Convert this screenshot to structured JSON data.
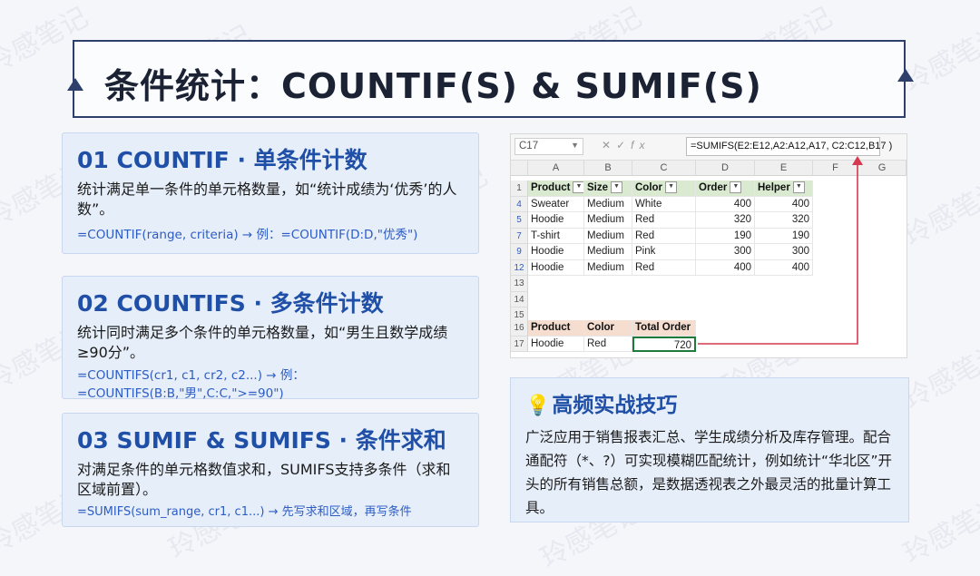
{
  "watermark": "玲感笔记",
  "title": "条件统计：COUNTIF(S) & SUMIF(S)",
  "cards": [
    {
      "heading": "01 COUNTIF · 单条件计数",
      "desc": "统计满足单一条件的单元格数量，如“统计成绩为‘优秀’的人数”。",
      "formula": "=COUNTIF(range, criteria) → 例：=COUNTIF(D:D,\"优秀\")"
    },
    {
      "heading": "02 COUNTIFS · 多条件计数",
      "desc": "统计同时满足多个条件的单元格数量，如“男生且数学成绩≥90分”。",
      "formula": "=COUNTIFS(cr1, c1, cr2, c2...) → 例：=COUNTIFS(B:B,\"男\",C:C,\">=90\")"
    },
    {
      "heading": "03 SUMIF & SUMIFS · 条件求和",
      "desc": "对满足条件的单元格数值求和，SUMIFS支持多条件（求和区域前置）。",
      "formula": "=SUMIFS(sum_range, cr1, c1...) → 先写求和区域，再写条件"
    }
  ],
  "sheet": {
    "name_box": "C17",
    "formula": "=SUMIFS(E2:E12,A2:A12,A17, C2:C12,B17 )",
    "columns": [
      "A",
      "B",
      "C",
      "D",
      "E",
      "F",
      "G"
    ],
    "table_header": [
      "Product",
      "Size",
      "Color",
      "Order",
      "Helper"
    ],
    "rows": [
      {
        "row": "4",
        "cells": [
          "Sweater",
          "Medium",
          "White",
          "400",
          "400"
        ]
      },
      {
        "row": "5",
        "cells": [
          "Hoodie",
          "Medium",
          "Red",
          "320",
          "320"
        ]
      },
      {
        "row": "7",
        "cells": [
          "T-shirt",
          "Medium",
          "Red",
          "190",
          "190"
        ]
      },
      {
        "row": "9",
        "cells": [
          "Hoodie",
          "Medium",
          "Pink",
          "300",
          "300"
        ]
      },
      {
        "row": "12",
        "cells": [
          "Hoodie",
          "Medium",
          "Red",
          "400",
          "400"
        ]
      }
    ],
    "empty_rows": [
      "13",
      "14",
      "15"
    ],
    "header_row_label": "1",
    "result_header_row": "16",
    "result_header": [
      "Product",
      "Color",
      "Total Order"
    ],
    "result_row": "17",
    "result_values": [
      "Hoodie",
      "Red",
      "720"
    ]
  },
  "tips": {
    "icon": "lightbulb-icon",
    "heading": "高频实战技巧",
    "body": "广泛应用于销售报表汇总、学生成绩分析及库存管理。配合通配符（*、?）可实现模糊匹配统计，例如统计“华北区”开头的所有销售总额，是数据透视表之外最灵活的批量计算工具。"
  },
  "colors": {
    "accent": "#1f4fa6",
    "formula_text": "#2d5cc4",
    "card_bg": "#e6eef9",
    "frame": "#2e3f6b",
    "arrow": "#d6394f"
  }
}
